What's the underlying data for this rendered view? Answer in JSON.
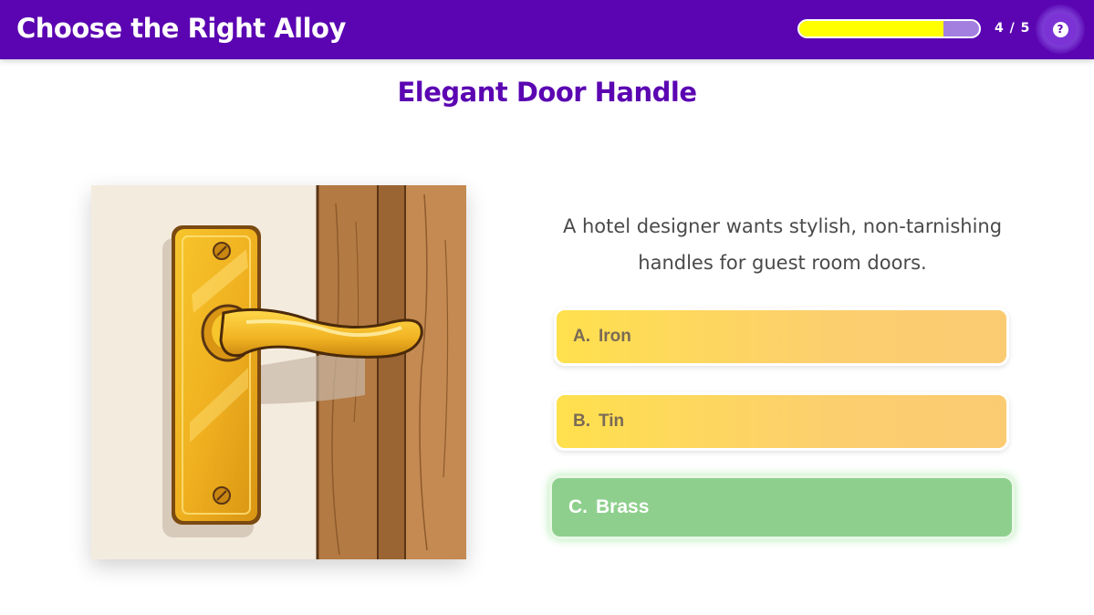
{
  "header": {
    "title": "Choose the Right Alloy",
    "progress_text": "4 / 5",
    "progress_fraction": 0.8,
    "help_icon": "question-mark-icon",
    "help_glyph": "?"
  },
  "question": {
    "title": "Elegant Door Handle",
    "prompt": "A hotel designer wants stylish, non-tarnishing handles for guest room doors.",
    "image": "door-handle-illustration"
  },
  "options": [
    {
      "letter": "A.",
      "label": "Iron",
      "state": "default"
    },
    {
      "letter": "B.",
      "label": "Tin",
      "state": "default"
    },
    {
      "letter": "C.",
      "label": "Brass",
      "state": "correct"
    }
  ],
  "colors": {
    "brand": "#5b05b2",
    "progress": "#ffff00",
    "option_default": "#fcd96a",
    "option_correct": "#8ecf8d"
  }
}
